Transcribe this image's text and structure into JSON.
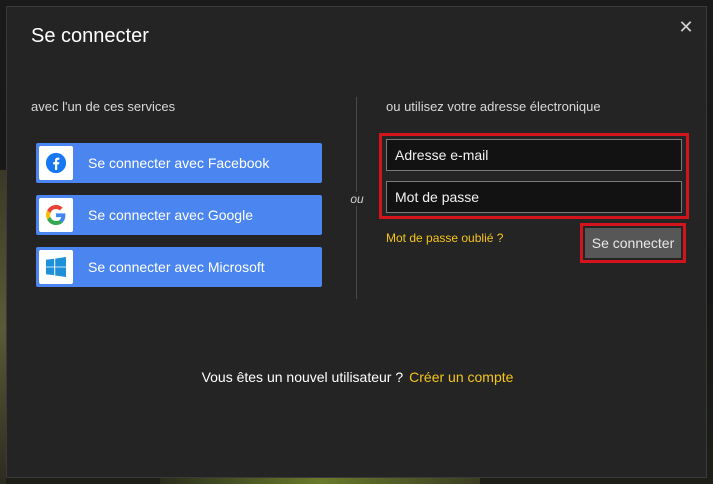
{
  "dialog": {
    "title": "Se connecter",
    "close_glyph": "✕"
  },
  "services": {
    "label": "avec l'un de ces services",
    "buttons": [
      {
        "label": "Se connecter avec Facebook",
        "icon": "facebook-icon",
        "color": "#4b86f0"
      },
      {
        "label": "Se connecter avec Google",
        "icon": "google-icon",
        "color": "#4b86f0"
      },
      {
        "label": "Se connecter avec Microsoft",
        "icon": "windows-icon",
        "color": "#4b86f0"
      }
    ]
  },
  "divider": {
    "text": "ou"
  },
  "email_login": {
    "label": "ou utilisez votre adresse électronique",
    "email_placeholder": "Adresse e-mail",
    "password_placeholder": "Mot de passe",
    "forgot_password": "Mot de passe oublié ?",
    "submit_label": "Se connecter"
  },
  "footer": {
    "text": "Vous êtes un nouvel utilisateur ?",
    "create_account": "Créer un compte"
  },
  "colors": {
    "accent_link": "#f5c518",
    "highlight_border": "#d4141c",
    "sso_button": "#4b86f0"
  }
}
